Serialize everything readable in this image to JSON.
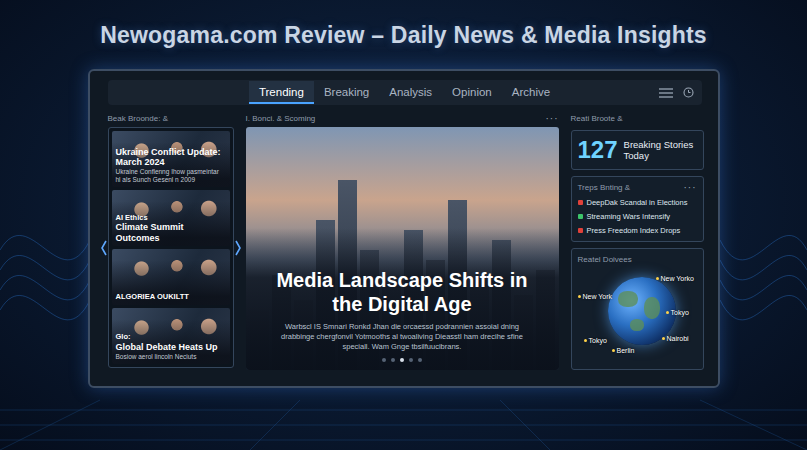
{
  "page_title": "Newogama.com Review – Daily News & Media Insights",
  "tabs": [
    {
      "label": "Trending",
      "selected": true
    },
    {
      "label": "Breaking",
      "selected": false
    },
    {
      "label": "Analysis",
      "selected": false
    },
    {
      "label": "Opinion",
      "selected": false
    },
    {
      "label": "Archive",
      "selected": false
    }
  ],
  "left_panel": {
    "header": "Beak Broonde: &",
    "cards": [
      {
        "title": "Ukraine Conflict Update: March 2024",
        "subtitle": "Ukraine Conflenng Ihow pasmeintar hl als Sunch Gesenl n 2009"
      },
      {
        "kicker": "AI Ethics",
        "title": "Climate Summit Outcomes"
      },
      {
        "kicker": "ALGORIEA OUKILTT"
      },
      {
        "kicker": "Glo:",
        "title": "Global Debate Heats Up",
        "subtitle": "Bosiow aerol lincoln Neciuts"
      }
    ]
  },
  "featured": {
    "header": "I. Bonci. & Scoming",
    "menu": "···",
    "headline": "Media Landscape Shifts in the Digital Age",
    "summary": "Warbscl IS Smnari Ronkd Jhan die orcaessd podrannien assoial dning drabbinge chergfonvil Yotmooths al twoaliving Dieasstl ham drecihe sfine speciall. Wam Gnge tbsilfuucibrans.",
    "dots": [
      {
        "selected": false
      },
      {
        "selected": false
      },
      {
        "selected": true
      },
      {
        "selected": false
      },
      {
        "selected": false
      }
    ]
  },
  "right_panel": {
    "header": "Reati Broote &",
    "stat": {
      "count": "127",
      "label": "Breaking Stories Today"
    },
    "trends": {
      "header": "Treps Bnting &",
      "menu": "···",
      "items": [
        {
          "label": "DeepDak Scandal in Elections",
          "color": "#e0413a"
        },
        {
          "label": "Streaming Wars Intensify",
          "color": "#3cc46a"
        },
        {
          "label": "Press Freedom Index Drops",
          "color": "#e0413a"
        }
      ]
    },
    "map": {
      "header": "Reatel Doivees",
      "pins": [
        {
          "label": "New York"
        },
        {
          "label": "New Yorko"
        },
        {
          "label": "Tokyo"
        },
        {
          "label": "Tokyo"
        },
        {
          "label": "Berlin"
        },
        {
          "label": "Nairobi"
        }
      ]
    }
  }
}
